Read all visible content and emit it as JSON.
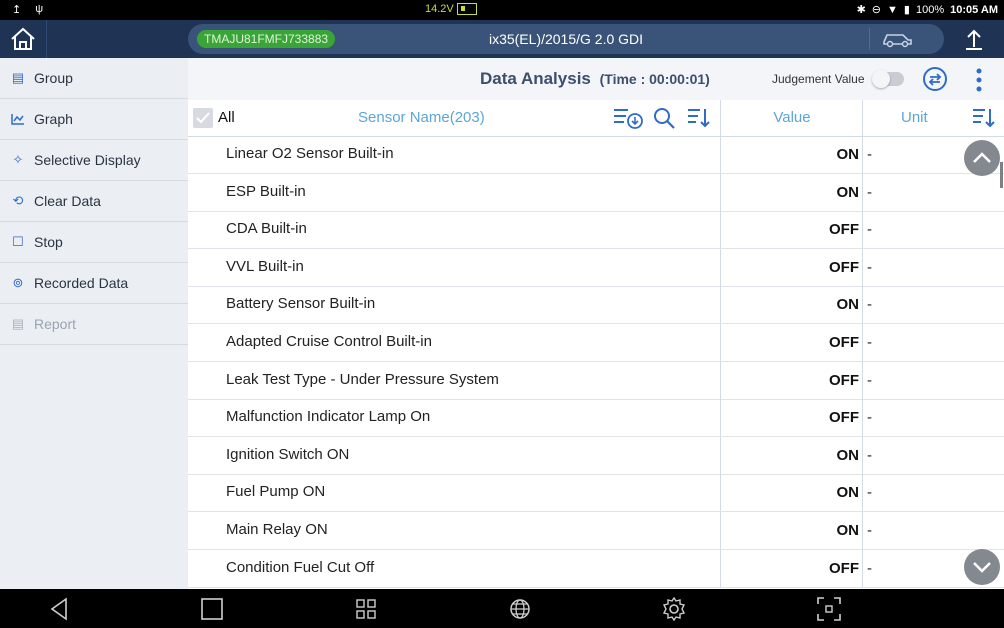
{
  "status_bar": {
    "voltage": "14.2V",
    "battery": "100%",
    "time": "10:05 AM"
  },
  "vehicle": {
    "vin": "TMAJU81FMFJ733883",
    "model": "ix35(EL)/2015/G 2.0 GDI"
  },
  "sidebar": {
    "items": [
      {
        "label": "Group",
        "icon": "group-icon"
      },
      {
        "label": "Graph",
        "icon": "graph-icon"
      },
      {
        "label": "Selective Display",
        "icon": "pin-icon"
      },
      {
        "label": "Clear Data",
        "icon": "clear-icon"
      },
      {
        "label": "Stop",
        "icon": "stop-icon"
      },
      {
        "label": "Recorded Data",
        "icon": "recorded-icon"
      },
      {
        "label": "Report",
        "icon": "report-icon",
        "disabled": true
      }
    ]
  },
  "header": {
    "title": "Data Analysis",
    "time": "(Time : 00:00:01)",
    "judgement_label": "Judgement Value"
  },
  "table": {
    "all_label": "All",
    "sensor_header": "Sensor Name(203)",
    "value_header": "Value",
    "unit_header": "Unit",
    "rows": [
      {
        "name": "Linear O2 Sensor Built-in",
        "value": "ON",
        "unit": "-"
      },
      {
        "name": "ESP Built-in",
        "value": "ON",
        "unit": "-"
      },
      {
        "name": "CDA Built-in",
        "value": "OFF",
        "unit": "-"
      },
      {
        "name": "VVL Built-in",
        "value": "OFF",
        "unit": "-"
      },
      {
        "name": "Battery Sensor Built-in",
        "value": "ON",
        "unit": "-"
      },
      {
        "name": "Adapted Cruise Control Built-in",
        "value": "OFF",
        "unit": "-"
      },
      {
        "name": "Leak Test Type - Under Pressure System",
        "value": "OFF",
        "unit": "-"
      },
      {
        "name": "Malfunction Indicator Lamp On",
        "value": "OFF",
        "unit": "-"
      },
      {
        "name": "Ignition Switch ON",
        "value": "ON",
        "unit": "-"
      },
      {
        "name": "Fuel Pump ON",
        "value": "ON",
        "unit": "-"
      },
      {
        "name": "Main Relay ON",
        "value": "ON",
        "unit": "-"
      },
      {
        "name": "Condition Fuel Cut Off",
        "value": "OFF",
        "unit": "-"
      }
    ]
  },
  "colors": {
    "topbar": "#1f3455",
    "vin_badge": "#3aa537",
    "header_text": "#5aa6d8",
    "sidebar_icon": "#2f6cc7"
  }
}
